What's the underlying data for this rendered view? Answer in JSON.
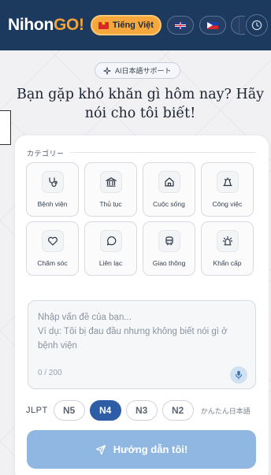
{
  "header": {
    "logo_main": "Nihon",
    "logo_accent": "GO!",
    "language_active": "Tiếng Việt",
    "language_options": [
      "english-flag",
      "philippines-flag",
      "partial-flag"
    ],
    "history_icon": "clock-icon"
  },
  "badge": {
    "icon": "sparkle-icon",
    "text": "AI日本語サポート"
  },
  "headline": "Bạn gặp khó khăn gì hôm nay? Hãy nói cho tôi biết!",
  "categories": {
    "title": "カテゴリー",
    "items": [
      {
        "label": "Bệnh viện",
        "icon": "stethoscope-icon"
      },
      {
        "label": "Thủ tục",
        "icon": "bank-icon"
      },
      {
        "label": "Cuộc sống",
        "icon": "home-icon"
      },
      {
        "label": "Công việc",
        "icon": "briefcase-icon"
      },
      {
        "label": "Chăm sóc",
        "icon": "heart-icon"
      },
      {
        "label": "Liên lạc",
        "icon": "chat-bubble-icon"
      },
      {
        "label": "Giao thông",
        "icon": "bus-icon"
      },
      {
        "label": "Khẩn cấp",
        "icon": "siren-icon"
      }
    ]
  },
  "input": {
    "placeholder_line1": "Nhập vấn đề của bạn...",
    "placeholder_line2": "Ví dụ: Tôi bị đau đầu nhưng không biết nói gì ở bệnh viện",
    "counter": "0 / 200",
    "mic_icon": "microphone-icon"
  },
  "jlpt": {
    "label": "JLPT",
    "levels": [
      "N5",
      "N4",
      "N3",
      "N2"
    ],
    "selected": "N4",
    "easy_label": "かんたん日本語"
  },
  "cta": {
    "icon": "send-icon",
    "label": "Hướng dẫn tôi!"
  },
  "colors": {
    "header": "#1b3a5e",
    "accent": "#f6a83c",
    "primary": "#2f5da5",
    "cta": "#8fb7e2"
  }
}
